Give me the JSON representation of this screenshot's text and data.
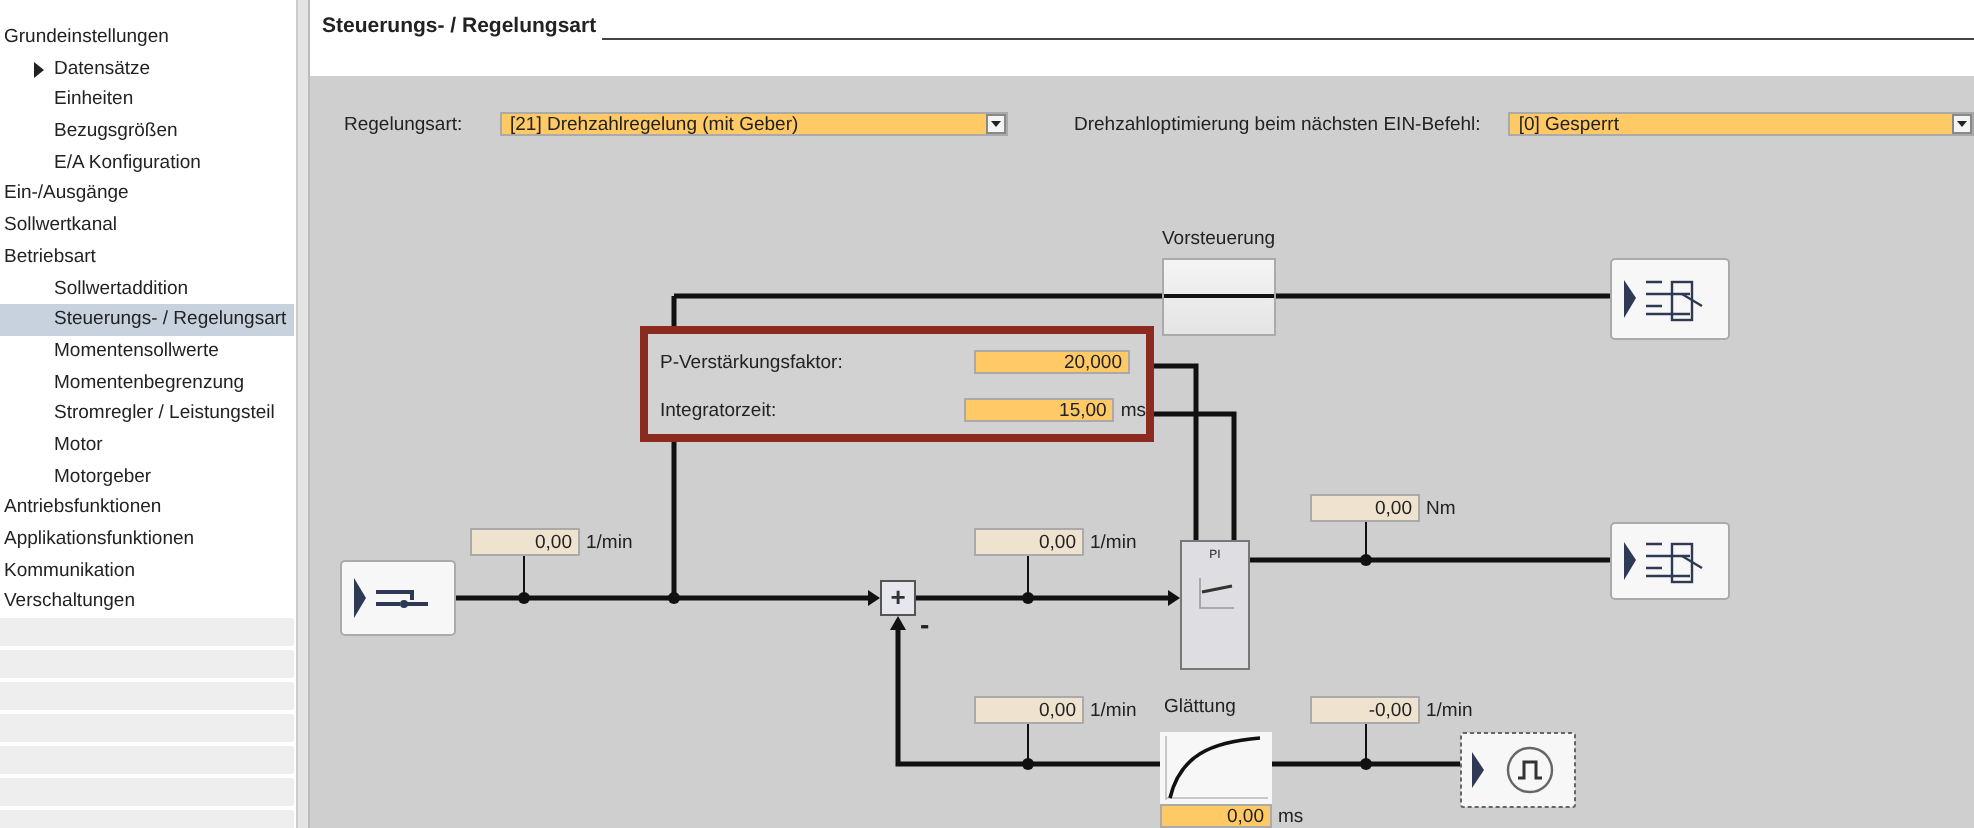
{
  "sidebar": {
    "items": [
      {
        "label": "Grundeinstellungen",
        "selected": false,
        "children": [
          {
            "label": "Datensätze",
            "selected": false,
            "expanded": false
          },
          {
            "label": "Einheiten",
            "selected": false
          },
          {
            "label": "Bezugsgrößen",
            "selected": false
          },
          {
            "label": "E/A Konfiguration",
            "selected": false
          }
        ]
      },
      {
        "label": "Ein-/Ausgänge",
        "selected": false
      },
      {
        "label": "Sollwertkanal",
        "selected": false
      },
      {
        "label": "Betriebsart",
        "selected": false,
        "children": [
          {
            "label": "Sollwertaddition",
            "selected": false
          },
          {
            "label": "Steuerungs- / Regelungsart",
            "selected": true
          },
          {
            "label": "Momentensollwerte",
            "selected": false
          },
          {
            "label": "Momentenbegrenzung",
            "selected": false
          },
          {
            "label": "Stromregler / Leistungsteil",
            "selected": false
          },
          {
            "label": "Motor",
            "selected": false
          },
          {
            "label": "Motorgeber",
            "selected": false
          }
        ]
      },
      {
        "label": "Antriebsfunktionen",
        "selected": false
      },
      {
        "label": "Applikationsfunktionen",
        "selected": false
      },
      {
        "label": "Kommunikation",
        "selected": false
      },
      {
        "label": "Verschaltungen",
        "selected": false
      }
    ]
  },
  "panel": {
    "title": "Steuerungs- / Regelungsart",
    "settings": [
      {
        "label": "Regelungsart:",
        "value": "[21] Drehzahlregelung (mit Geber)"
      },
      {
        "label": "Drehzahloptimierung beim nächsten EIN-Befehl:",
        "value": "[0] Gesperrt"
      }
    ],
    "diagram": {
      "feedforward_label": "Vorsteuerung",
      "controller_params": [
        {
          "label": "P-Verstärkungsfaktor:",
          "value": "20,000"
        },
        {
          "label": "Integratorzeit:",
          "value": "15,00",
          "unit": "ms"
        }
      ],
      "readouts": [
        {
          "value": "0,00",
          "unit": "1/min"
        },
        {
          "value": "0,00",
          "unit": "1/min"
        },
        {
          "value": "0,00",
          "unit": "Nm"
        },
        {
          "value": "0,00",
          "unit": "1/min"
        },
        {
          "value": "-0,00",
          "unit": "1/min"
        }
      ],
      "sum_sign": "+",
      "minus_sign": "-",
      "pi_label": "PI",
      "smoothing": {
        "label": "Glättung",
        "value": "0,00",
        "unit": "ms"
      }
    }
  }
}
